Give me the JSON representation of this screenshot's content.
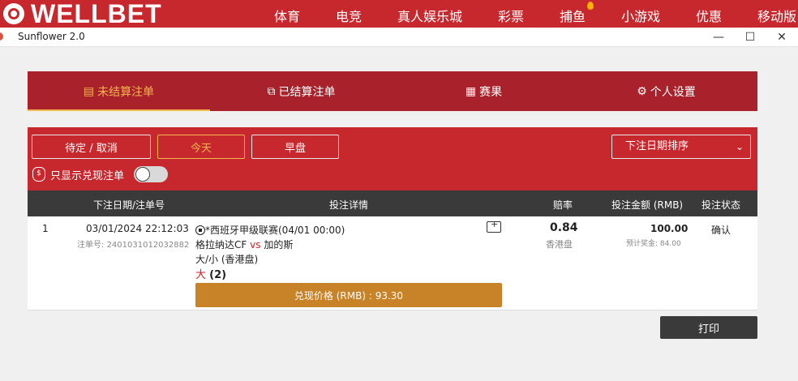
{
  "brand": {
    "name": "WELLBET"
  },
  "nav": {
    "items": [
      "体育",
      "电竞",
      "真人娱乐城",
      "彩票",
      "捕鱼",
      "小游戏",
      "优惠",
      "移动版"
    ]
  },
  "window": {
    "title": "Sunflower 2.0",
    "minimize": "—",
    "maximize": "☐",
    "close": "✕"
  },
  "tabs": [
    {
      "icon": "document-icon",
      "label": "未结算注单"
    },
    {
      "icon": "copy-icon",
      "label": "已结算注单"
    },
    {
      "icon": "board-icon",
      "label": "赛果"
    },
    {
      "icon": "gear-icon",
      "label": "个人设置"
    }
  ],
  "filters": {
    "pending_label": "待定 / 取消",
    "today_label": "今天",
    "early_label": "早盘",
    "sort_value": "下注日期排序",
    "cashout_only_label": "只显示兑现注单",
    "cashout_only_on": false
  },
  "table": {
    "headers": {
      "date": "下注日期/注单号",
      "details": "投注详情",
      "odds": "赔率",
      "stake": "投注金额 (RMB)",
      "status": "投注状态"
    }
  },
  "bet": {
    "index": "1",
    "datetime": "03/01/2024 22:12:03",
    "ticket_label": "注单号: ",
    "ticket_no": "2401031012032882",
    "league": "*西班牙甲级联赛(04/01 00:00)",
    "home": "格拉纳达CF",
    "vs": "vs",
    "away": "加的斯",
    "market": "大/小 (香港盘)",
    "selection": "大",
    "line": "(2)",
    "odds": "0.84",
    "odds_type": "香港盘",
    "stake": "100.00",
    "est_win_label": "预计奖金: ",
    "est_win": "84.00",
    "status": "确认",
    "cashout_text": "兑现价格 (RMB) : 93.30"
  },
  "print_label": "打印"
}
